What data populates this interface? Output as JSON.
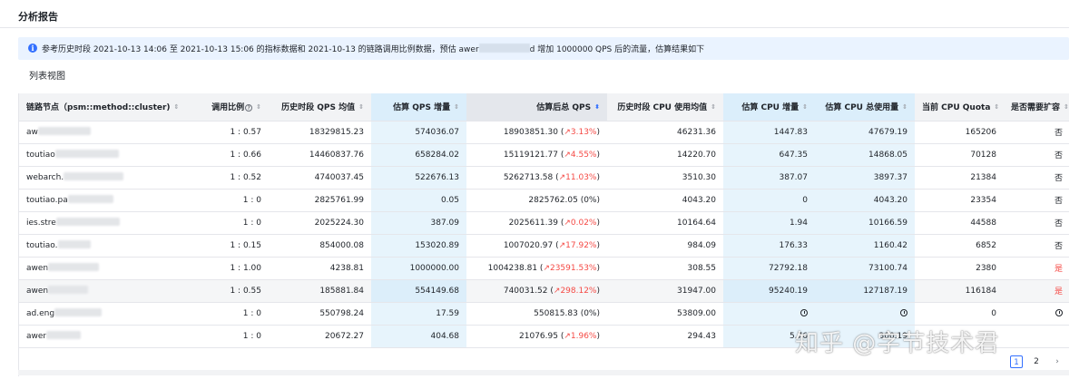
{
  "page": {
    "title": "分析报告"
  },
  "info": {
    "prefix": "参考历史时段 2021-10-13 14:06 至 2021-10-13 15:06 的指标数据和 2021-10-13 的链路调用比例数据，预估 awer",
    "suffix": "d 增加 1000000 QPS 后的流量，估算结果如下"
  },
  "section": {
    "title": "列表视图"
  },
  "table": {
    "headers": {
      "node": "链路节点（psm::method::cluster)",
      "ratio": "调用比例",
      "hist_qps": "历史时段 QPS 均值",
      "qps_inc": "估算 QPS 增量",
      "total_qps": "估算后总 QPS",
      "hist_cpu": "历史时段 CPU 使用均值",
      "cpu_inc": "估算 CPU 增量",
      "cpu_total": "估算 CPU 总使用量",
      "quota": "当前 CPU Quota",
      "need": "是否需要扩容"
    },
    "rows": [
      {
        "node": "aw",
        "ratio": "1 : 0.57",
        "hist_qps": "18329815.23",
        "qps_inc": "574036.07",
        "total_qps": "18903851.30",
        "pct": "3.13%",
        "hist_cpu": "46231.36",
        "cpu_inc": "1447.83",
        "cpu_total": "47679.19",
        "quota": "165206",
        "need": "否"
      },
      {
        "node": "toutiao",
        "ratio": "1 : 0.66",
        "hist_qps": "14460837.76",
        "qps_inc": "658284.02",
        "total_qps": "15119121.77",
        "pct": "4.55%",
        "hist_cpu": "14220.70",
        "cpu_inc": "647.35",
        "cpu_total": "14868.05",
        "quota": "70128",
        "need": "否"
      },
      {
        "node": "webarch.",
        "ratio": "1 : 0.52",
        "hist_qps": "4740037.45",
        "qps_inc": "522676.13",
        "total_qps": "5262713.58",
        "pct": "11.03%",
        "hist_cpu": "3510.30",
        "cpu_inc": "387.07",
        "cpu_total": "3897.37",
        "quota": "21384",
        "need": "否"
      },
      {
        "node": "toutiao.pa",
        "ratio": "1 : 0",
        "hist_qps": "2825761.99",
        "qps_inc": "0.05",
        "total_qps": "2825762.05",
        "pct": "0%",
        "hist_cpu": "4043.20",
        "cpu_inc": "0",
        "cpu_total": "4043.20",
        "quota": "23354",
        "need": "否"
      },
      {
        "node": "ies.stre",
        "ratio": "1 : 0",
        "hist_qps": "2025224.30",
        "qps_inc": "387.09",
        "total_qps": "2025611.39",
        "pct": "0.02%",
        "hist_cpu": "10164.64",
        "cpu_inc": "1.94",
        "cpu_total": "10166.59",
        "quota": "44588",
        "need": "否"
      },
      {
        "node": "toutiao.",
        "ratio": "1 : 0.15",
        "hist_qps": "854000.08",
        "qps_inc": "153020.89",
        "total_qps": "1007020.97",
        "pct": "17.92%",
        "hist_cpu": "984.09",
        "cpu_inc": "176.33",
        "cpu_total": "1160.42",
        "quota": "6852",
        "need": "否"
      },
      {
        "node": "awen",
        "ratio": "1 : 1.00",
        "hist_qps": "4238.81",
        "qps_inc": "1000000.00",
        "total_qps": "1004238.81",
        "pct": "23591.53%",
        "hist_cpu": "308.55",
        "cpu_inc": "72792.18",
        "cpu_total": "73100.74",
        "quota": "2380",
        "need": "是"
      },
      {
        "node": "awen",
        "ratio": "1 : 0.55",
        "hist_qps": "185881.84",
        "qps_inc": "554149.68",
        "total_qps": "740031.52",
        "pct": "298.12%",
        "hist_cpu": "31947.00",
        "cpu_inc": "95240.19",
        "cpu_total": "127187.19",
        "quota": "116184",
        "need": "是"
      },
      {
        "node": "ad.eng",
        "ratio": "1 : 0",
        "hist_qps": "550798.24",
        "qps_inc": "17.59",
        "total_qps": "550815.83",
        "pct": "0%",
        "hist_cpu": "53809.00",
        "cpu_inc": "",
        "cpu_total": "",
        "quota": "0",
        "need": ""
      },
      {
        "node": "awer",
        "ratio": "1 : 0",
        "hist_qps": "20672.27",
        "qps_inc": "404.68",
        "total_qps": "21076.95",
        "pct": "1.96%",
        "hist_cpu": "294.43",
        "cpu_inc": "5.76",
        "cpu_total": "300.19",
        "quota": "",
        "need": ""
      }
    ]
  },
  "pager": {
    "page1": "1",
    "page2": "2",
    "next": "›"
  },
  "watermark": "知乎 @字节技术君",
  "colors": {
    "accent": "#3370ff",
    "danger": "#f54a45",
    "highlight_col": "#e7f4fc",
    "info_bg": "#eaf3ff"
  }
}
